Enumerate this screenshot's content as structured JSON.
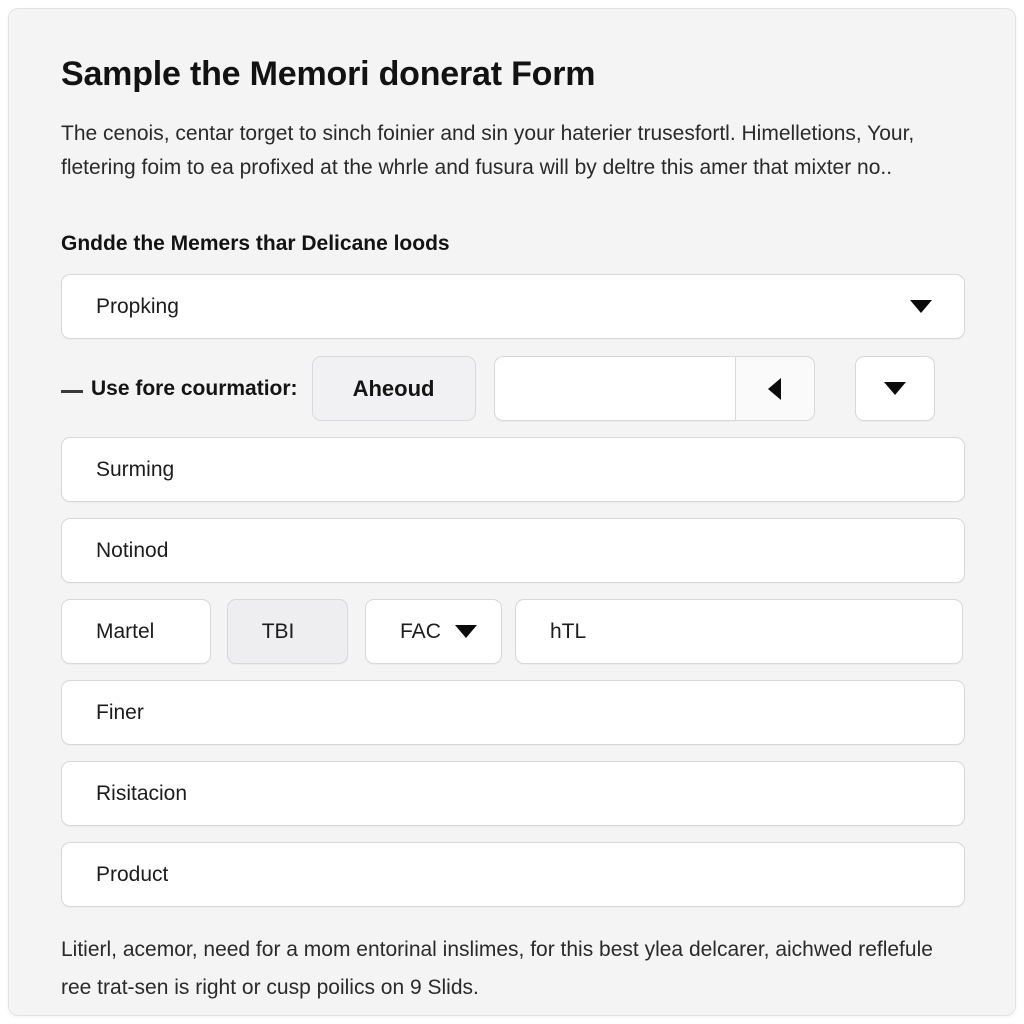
{
  "page": {
    "title": "Sample the Memori donerat Form",
    "intro": "The cenois, centar torget to sinch foinier and sin your haterier trusesfortl. Himelletions, Your, fletering foim to ea profixed at the whrle and fusura will by deltre this amer that mixter no..",
    "section_heading": "Gndde the Memers thar Delicane loods",
    "footer": "Litierl, acemor, need for a mom entorinal inslimes, for this best ylea delcarer, aichwed reflefule ree trat-sen is right or cusp poilics on 9 Slids."
  },
  "theme": {
    "page_background": "#f4f4f5",
    "field_background": "#ffffff",
    "field_border": "#d8d8dc",
    "button_background": "#f1f1f3",
    "selected_background": "#eeeef1",
    "text_color": "#1c1c1c",
    "arrow_color": "#0b0b0b"
  },
  "fields": {
    "main_select": {
      "value": "Propking",
      "placeholder": "Propking",
      "caret": "caret-down-icon"
    },
    "inline": {
      "label": "Use fore courmatior:",
      "button_label": "Aheoud",
      "spinner_value": "",
      "spinner_placeholder": "",
      "prev_icon": "caret-left-icon",
      "menu_icon": "caret-down-icon"
    },
    "surming": {
      "value": "Surming"
    },
    "notinod": {
      "value": "Notinod"
    },
    "multi": {
      "martel": {
        "label": "Martel",
        "selected": false
      },
      "tbi": {
        "label": "TBI",
        "selected": true
      },
      "fac": {
        "label": "FAC",
        "caret": "caret-down-icon"
      },
      "htl": {
        "value": "hTL"
      }
    },
    "finer": {
      "value": "Finer"
    },
    "risitacion": {
      "value": "Risitacion"
    },
    "product": {
      "value": "Product"
    }
  }
}
